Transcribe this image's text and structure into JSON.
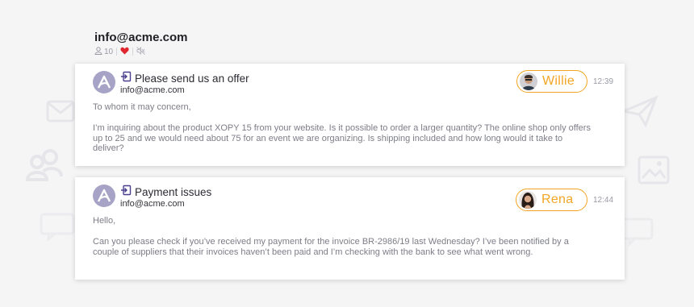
{
  "inbox": {
    "title": "info@acme.com",
    "member_count": "10",
    "icons": [
      "user-icon",
      "heart-icon",
      "mute-icon"
    ],
    "heart_color": "#e0262f"
  },
  "messages": [
    {
      "subject": "Please send us an offer",
      "from": "info@acme.com",
      "greeting": "To whom it may concern,",
      "body": "I’m inquiring about the product XOPY 15 from your website. Is it possible to order a larger quantity? The online shop only offers up to 25 and we would need about 75 for an event we are organizing. Is shipping included and how long would it take to deliver?",
      "agent": "Willie",
      "time": "12:39"
    },
    {
      "subject": "Payment issues",
      "from": "info@acme.com",
      "greeting": "Hello,",
      "body": "Can you please check if you’ve received my payment for the invoice BR-2986/19 last Wednesday? I’ve been notified by a couple of suppliers that their invoices haven’t been paid and I’m checking with the bank to see what went wrong.",
      "agent": "Rena",
      "time": "12:44"
    }
  ],
  "colors": {
    "accent": "#f2a523",
    "logo_avatar": "#a7a3c7",
    "background": "#f5f5f6"
  }
}
